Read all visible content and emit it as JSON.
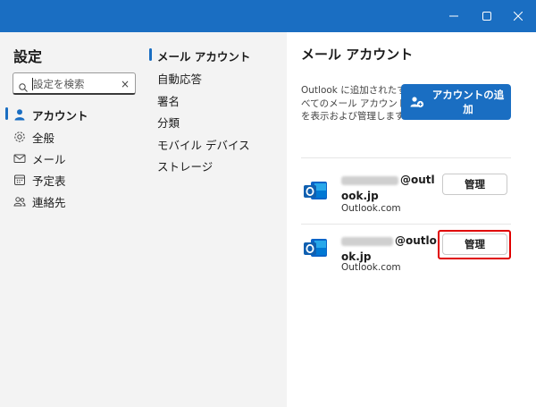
{
  "window": {
    "minimize_icon": "minimize-icon",
    "maximize_icon": "maximize-icon",
    "close_icon": "close-icon",
    "accent_color": "#1a6ec2"
  },
  "left": {
    "title": "設定",
    "search": {
      "placeholder": "設定を検索",
      "value": "",
      "clear_icon": "×"
    },
    "nav": [
      {
        "label": "アカウント",
        "icon": "person-icon",
        "active": true
      },
      {
        "label": "全般",
        "icon": "gear-icon",
        "active": false
      },
      {
        "label": "メール",
        "icon": "mail-icon",
        "active": false
      },
      {
        "label": "予定表",
        "icon": "calendar-icon",
        "active": false
      },
      {
        "label": "連絡先",
        "icon": "people-icon",
        "active": false
      }
    ]
  },
  "middle": {
    "items": [
      {
        "label": "メール アカウント",
        "active": true
      },
      {
        "label": "自動応答"
      },
      {
        "label": "署名"
      },
      {
        "label": "分類"
      },
      {
        "label": "モバイル デバイス"
      },
      {
        "label": "ストレージ"
      }
    ]
  },
  "right": {
    "title": "メール アカウント",
    "description": "Outlook に追加されたすべてのメール アカウントを表示および管理します",
    "add_button": {
      "label": "アカウントの追加",
      "icon": "add-person-icon"
    },
    "accounts": [
      {
        "email_suffix": "@outlook.jp",
        "provider": "Outlook.com",
        "manage_label": "管理",
        "highlighted": false
      },
      {
        "email_suffix": "@outlook.jp",
        "provider": "Outlook.com",
        "manage_label": "管理",
        "highlighted": true
      }
    ],
    "highlight_color": "#e00000"
  }
}
